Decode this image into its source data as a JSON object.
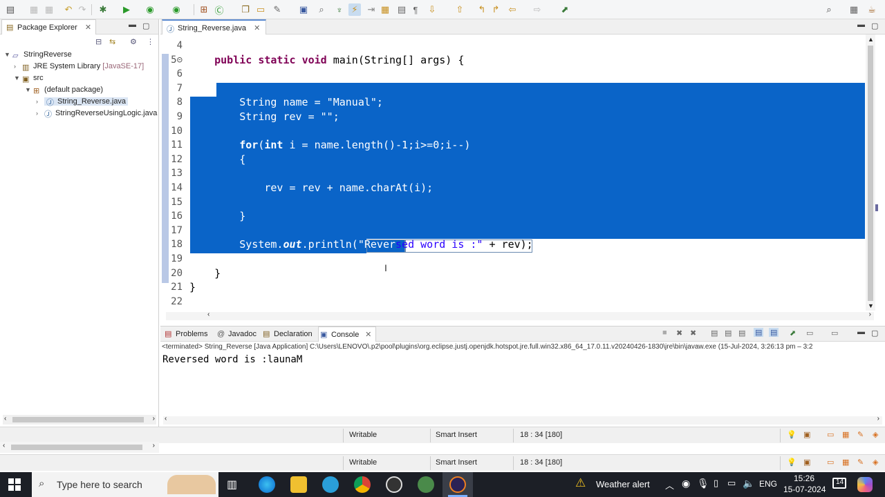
{
  "toolbar": {
    "icons": [
      "new-icon",
      "save-icon",
      "save-all-icon",
      "undo-icon",
      "redo-icon",
      "debug-icon",
      "run-icon",
      "run-dropdown-icon",
      "coverage-icon",
      "external-tools-icon",
      "new-package-icon",
      "new-class-icon",
      "open-type-icon",
      "open-task-icon",
      "search-icon",
      "toggle-mark-icon",
      "annotation-icon",
      "word-wrap-icon",
      "show-whitespace-icon",
      "nav-back-icon",
      "nav-forward-icon",
      "perspective-icon"
    ]
  },
  "package_explorer": {
    "title": "Package Explorer",
    "tree": [
      {
        "label": "StringReverse",
        "level": 0
      },
      {
        "label": "JRE System Library",
        "suffix": "[JavaSE-17]",
        "level": 1
      },
      {
        "label": "src",
        "level": 1
      },
      {
        "label": "(default package)",
        "level": 2
      },
      {
        "label": "String_Reverse.java",
        "level": 3
      },
      {
        "label": "StringReverseUsingLogic.java",
        "level": 3
      }
    ]
  },
  "editor": {
    "tab_label": "String_Reverse.java",
    "lines": [
      {
        "num": "4",
        "text": ""
      },
      {
        "num": "5⊝",
        "text": "    public static void main(String[] args) {"
      },
      {
        "num": "6",
        "text": ""
      },
      {
        "num": "7",
        "text": ""
      },
      {
        "num": "8",
        "text": "        String name = \"Manual\";"
      },
      {
        "num": "9",
        "text": "        String rev = \"\";"
      },
      {
        "num": "10",
        "text": ""
      },
      {
        "num": "11",
        "text": "        for(int i = name.length()-1;i>=0;i--)"
      },
      {
        "num": "12",
        "text": "        {"
      },
      {
        "num": "13",
        "text": ""
      },
      {
        "num": "14",
        "text": "            rev = rev + name.charAt(i);"
      },
      {
        "num": "15",
        "text": ""
      },
      {
        "num": "16",
        "text": "        }"
      },
      {
        "num": "17",
        "text": ""
      },
      {
        "num": "18",
        "text": "        System.out.println(\"Reversed word is :\" + rev);"
      },
      {
        "num": "19",
        "text": ""
      },
      {
        "num": "20",
        "text": "    }"
      },
      {
        "num": "21",
        "text": "}"
      },
      {
        "num": "22",
        "text": ""
      }
    ]
  },
  "console": {
    "tabs": [
      "Problems",
      "Javadoc",
      "Declaration",
      "Console"
    ],
    "header": "<terminated> String_Reverse [Java Application] C:\\Users\\LENOVO\\.p2\\pool\\plugins\\org.eclipse.justj.openjdk.hotspot.jre.full.win32.x86_64_17.0.11.v20240426-1830\\jre\\bin\\javaw.exe  (15-Jul-2024, 3:26:13 pm – 3:2",
    "output": "Reversed word is :launaM"
  },
  "status": {
    "writable": "Writable",
    "insert_mode": "Smart Insert",
    "position": "18 : 34 [180]"
  },
  "taskbar": {
    "search_placeholder": "Type here to search",
    "weather": "Weather alert",
    "language": "ENG",
    "time": "15:26",
    "date": "15-07-2024",
    "notifications": "14"
  },
  "colors": {
    "selection": "#0a64c8",
    "keyword": "#7f0055",
    "taskbar": "#1c1f26"
  }
}
